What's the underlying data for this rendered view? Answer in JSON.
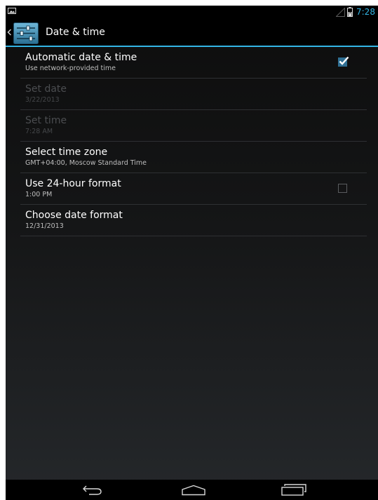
{
  "status_bar": {
    "time": "7:28"
  },
  "action_bar": {
    "title": "Date & time"
  },
  "settings": [
    {
      "title": "Automatic date & time",
      "summary": "Use network-provided time",
      "enabled": true,
      "checkbox": true,
      "checked": true
    },
    {
      "title": "Set date",
      "summary": "3/22/2013",
      "enabled": false
    },
    {
      "title": "Set time",
      "summary": "7:28 AM",
      "enabled": false
    },
    {
      "title": "Select time zone",
      "summary": "GMT+04:00, Moscow Standard Time",
      "enabled": true
    },
    {
      "title": "Use 24-hour format",
      "summary": "1:00 PM",
      "enabled": true,
      "checkbox": true,
      "checked": false
    },
    {
      "title": "Choose date format",
      "summary": "12/31/2013",
      "enabled": true
    }
  ],
  "icons": {
    "notification": "image-notification-icon",
    "signal": "signal-icon",
    "battery": "battery-icon",
    "up": "back-chevron-icon",
    "app": "settings-sliders-icon",
    "nav_back": "back-arrow-icon",
    "nav_home": "home-icon",
    "nav_recents": "recent-apps-icon"
  },
  "colors": {
    "accent": "#33b5e5",
    "checked_box": "#2f6f93",
    "disabled_text": "#4b4d50"
  }
}
